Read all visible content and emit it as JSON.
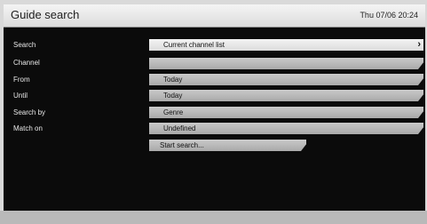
{
  "header": {
    "title": "Guide search",
    "datetime": "Thu 07/06 20:24"
  },
  "form": {
    "rows": [
      {
        "label": "Search",
        "value": "Current channel list",
        "icon": "chevron-right-icon"
      },
      {
        "label": "Channel",
        "value": ""
      },
      {
        "label": "From",
        "value": "Today"
      },
      {
        "label": "Until",
        "value": "Today"
      },
      {
        "label": "Search by",
        "value": "Genre"
      },
      {
        "label": "Match on",
        "value": "Undefined"
      }
    ],
    "start_label": "Start search..."
  }
}
